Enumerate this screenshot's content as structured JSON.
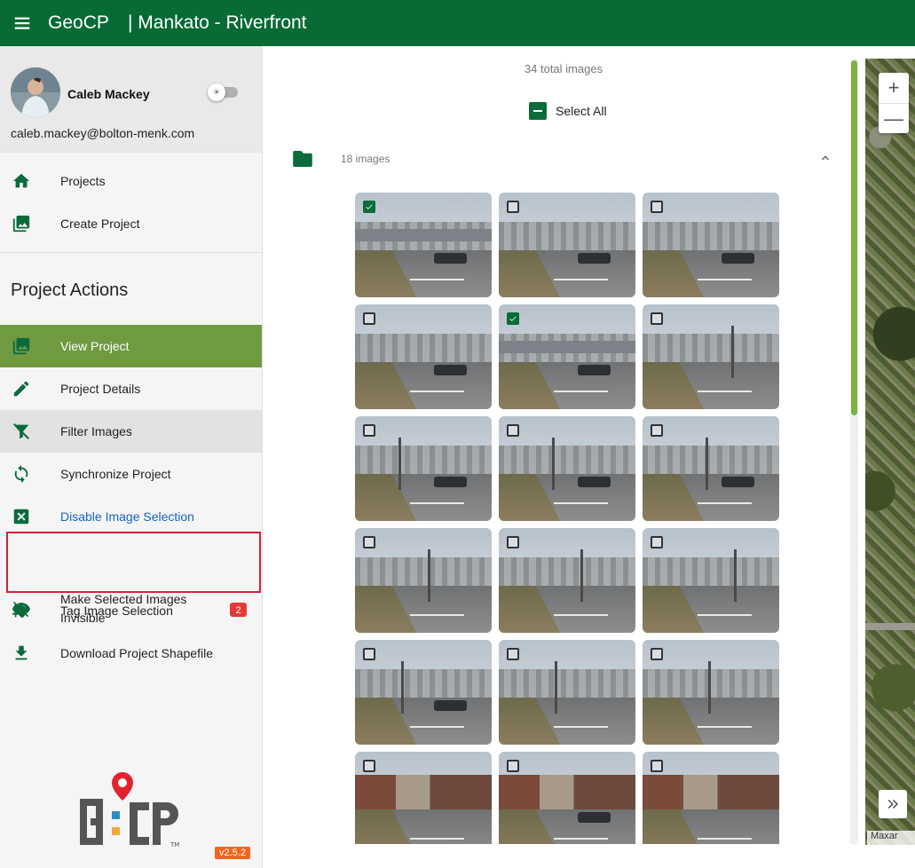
{
  "header": {
    "app_title": "GeoCP",
    "project_title": "| Mankato - Riverfront"
  },
  "user": {
    "name": "Caleb Mackey",
    "email": "caleb.mackey@bolton-menk.com"
  },
  "nav": {
    "projects": "Projects",
    "create_project": "Create Project"
  },
  "project_actions": {
    "title": "Project Actions",
    "view_project": "View Project",
    "project_details": "Project Details",
    "filter_images": "Filter Images",
    "synchronize_project": "Synchronize Project",
    "disable_image_selection": "Disable Image Selection",
    "make_invisible_line1": "Make Selected Images",
    "make_invisible_line2": "Invisible",
    "make_invisible_badge": "2",
    "tag_image_selection": "Tag Image Selection",
    "tag_badge": "2",
    "download_shapefile": "Download Project Shapefile"
  },
  "footer": {
    "version": "v2.5.2"
  },
  "images": {
    "total_label": "34 total images",
    "select_all_label": "Select All",
    "group_count_label": "18 images",
    "thumbnails": [
      {
        "selected": true,
        "scene": "bridge"
      },
      {
        "selected": false,
        "scene": "cars"
      },
      {
        "selected": false,
        "scene": "cars"
      },
      {
        "selected": false,
        "scene": "cars"
      },
      {
        "selected": true,
        "scene": "bridge"
      },
      {
        "selected": false,
        "scene": "road"
      },
      {
        "selected": false,
        "scene": "intersection"
      },
      {
        "selected": false,
        "scene": "intersection"
      },
      {
        "selected": false,
        "scene": "road"
      },
      {
        "selected": false,
        "scene": "road"
      },
      {
        "selected": false,
        "scene": "road"
      },
      {
        "selected": false,
        "scene": "road"
      },
      {
        "selected": false,
        "scene": "road"
      },
      {
        "selected": false,
        "scene": "road"
      },
      {
        "selected": false,
        "scene": "road"
      },
      {
        "selected": false,
        "scene": "buildings"
      },
      {
        "selected": false,
        "scene": "buildings"
      },
      {
        "selected": false,
        "scene": "buildings"
      }
    ]
  },
  "map": {
    "zoom_in": "+",
    "zoom_out": "—",
    "attribution": "Maxar"
  },
  "colors": {
    "brand_green": "#086a35",
    "active_nav": "#6f9a40",
    "badge_red": "#e53935",
    "highlight_red": "#d6203b",
    "version_orange": "#f0661e"
  }
}
